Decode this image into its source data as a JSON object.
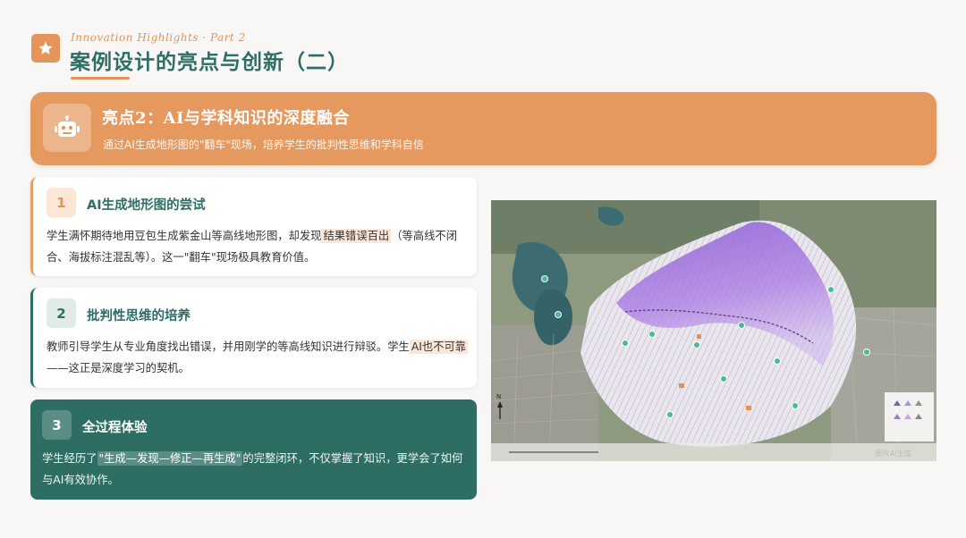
{
  "header": {
    "eyebrow": "Innovation Highlights · Part 2",
    "title": "案例设计的亮点与创新（二）",
    "badge_icon": "star-icon"
  },
  "banner": {
    "icon": "robot-icon",
    "title": "亮点2：AI与学科知识的深度融合",
    "subtitle": "通过AI生成地形图的\"翻车\"现场，培养学生的批判性思维和学科自信",
    "color": "#e5995f"
  },
  "cards": [
    {
      "number": "1",
      "title": "AI生成地形图的尝试",
      "body_before": "学生满怀期待地用豆包生成紫金山等高线地形图，却发现",
      "body_highlight": "结果错误百出",
      "body_after": "（等高线不闭合、海拔标注混乱等）。这一\"翻车\"现场极具教育价值。"
    },
    {
      "number": "2",
      "title": "批判性思维的培养",
      "body_before": "教师引导学生从专业角度找出错误，并用刚学的等高线知识进行辩驳。学生",
      "body_highlight": "AI也不可靠",
      "body_after": "——这正是深度学习的契机。"
    },
    {
      "number": "3",
      "title": "全过程体验",
      "body_before": "学生经历了",
      "body_highlight": "\"生成—发现—修正—再生成\"",
      "body_after": "的完整闭环，不仅掌握了知识，更学会了如何与AI有效协作。"
    }
  ],
  "map": {
    "north_label": "N",
    "watermark": "图片AI生成"
  },
  "colors": {
    "accent_orange": "#e5995f",
    "primary_teal": "#2d6e66",
    "background": "#f8f7f5"
  }
}
